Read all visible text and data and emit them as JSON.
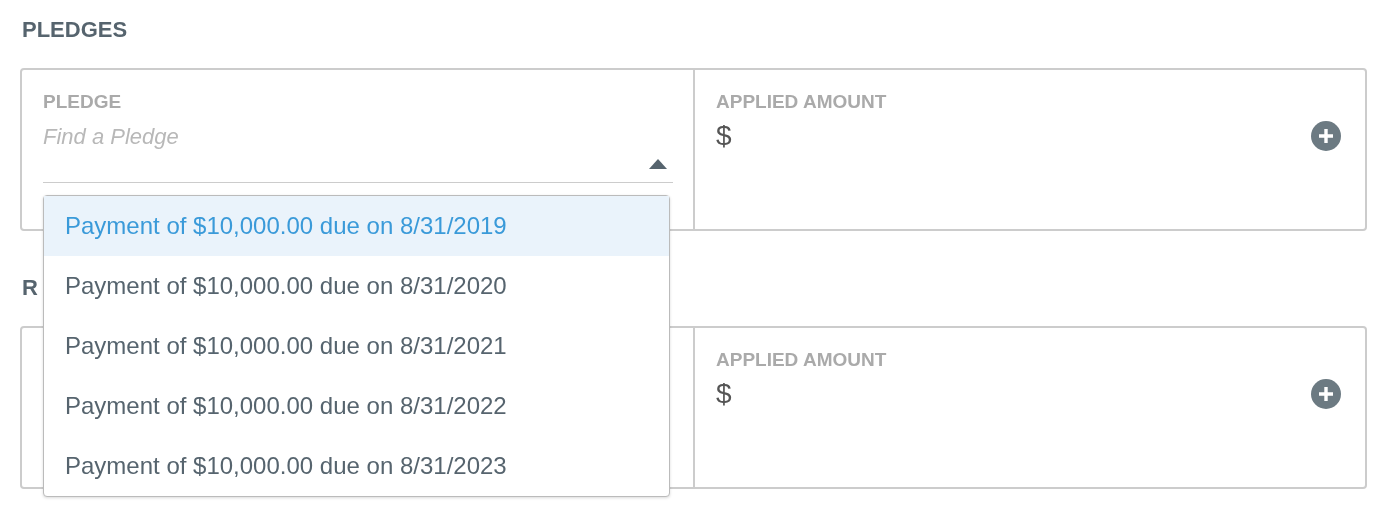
{
  "sections": [
    {
      "heading": "PLEDGES",
      "pledge_field": {
        "label": "PLEDGE",
        "placeholder": "Find a Pledge",
        "expanded": true
      },
      "amount": {
        "label": "APPLIED AMOUNT",
        "value": "$"
      }
    },
    {
      "heading": "R",
      "amount": {
        "label": "APPLIED AMOUNT",
        "value": "$"
      }
    }
  ],
  "dropdown": {
    "options": [
      {
        "label": "Payment of $10,000.00 due on 8/31/2019",
        "selected": true
      },
      {
        "label": "Payment of $10,000.00 due on 8/31/2020",
        "selected": false
      },
      {
        "label": "Payment of $10,000.00 due on 8/31/2021",
        "selected": false
      },
      {
        "label": "Payment of $10,000.00 due on 8/31/2022",
        "selected": false
      },
      {
        "label": "Payment of $10,000.00 due on 8/31/2023",
        "selected": false
      }
    ]
  }
}
